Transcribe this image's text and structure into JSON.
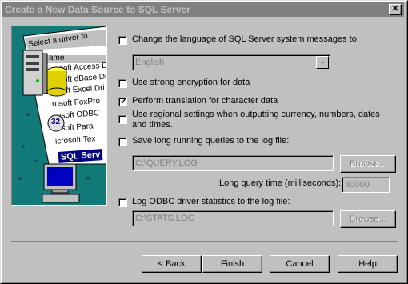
{
  "window": {
    "title": "Create a New Data Source to SQL Server",
    "close_glyph": "✕"
  },
  "art": {
    "header": "Select a driver fo",
    "col": "ame",
    "drivers": [
      "rosoft Access D",
      "rosoft dBase Dr",
      "rosoft Excel Dri",
      "rosoft FoxPro",
      "osoft ODBC",
      "osoft Para",
      "icrosoft Tex",
      "SQL Serv"
    ],
    "badge": "32"
  },
  "options": {
    "language_label": "Change the language of SQL Server system messages to:",
    "language_value": "English",
    "strong_encryption": "Use strong encryption for data",
    "translation": "Perform translation for character data",
    "regional": "Use regional settings when outputting currency, numbers, dates and times.",
    "save_long": "Save long running queries to the log file:",
    "query_log_path": "C:\\QUERY.LOG",
    "browse1": "Browse...",
    "long_query_label": "Long query time (milliseconds):",
    "long_query_value": "30000",
    "log_odbc": "Log ODBC driver statistics to the log file:",
    "stats_log_path": "C:\\STATS.LOG",
    "browse2": "Browse..."
  },
  "buttons": {
    "back": "< Back",
    "finish": "Finish",
    "cancel": "Cancel",
    "help": "Help"
  },
  "check_glyph": "✓"
}
